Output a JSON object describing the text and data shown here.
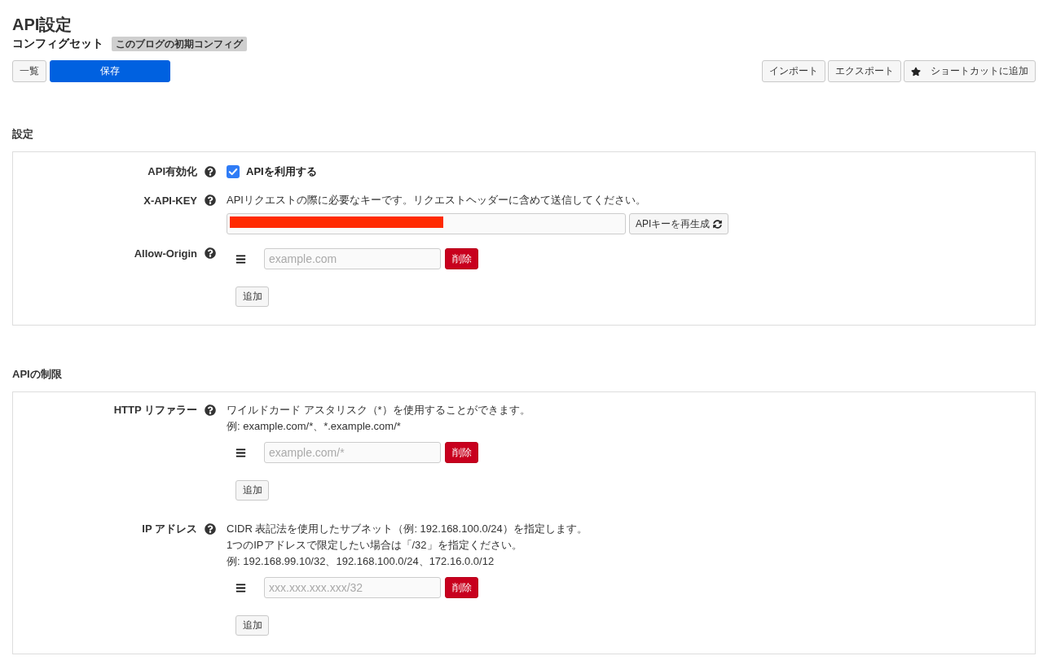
{
  "title": "API設定",
  "config_set": {
    "label": "コンフィグセット",
    "badge": "このブログの初期コンフィグ"
  },
  "toolbar": {
    "left": [
      {
        "label": "一覧",
        "kind": "default"
      },
      {
        "label": "保存",
        "kind": "primary"
      }
    ],
    "right": [
      {
        "label": "インポート",
        "kind": "default"
      },
      {
        "label": "エクスポート",
        "kind": "default"
      },
      {
        "label": "ショートカットに追加",
        "kind": "shortcut"
      }
    ]
  },
  "sections": [
    {
      "heading": "設定",
      "fields": [
        {
          "kind": "checkbox",
          "label": "API有効化",
          "checkbox": {
            "label": "APIを利用する",
            "checked": true
          }
        },
        {
          "kind": "api_key",
          "label": "X-API-KEY",
          "description": [
            "APIリクエストの際に必要なキーです。リクエストヘッダーに含めて送信してください。"
          ],
          "key_field": {
            "masked": true
          },
          "regenerate_button": "APIキーを再生成"
        },
        {
          "kind": "list",
          "label": "Allow-Origin",
          "items": [
            {
              "placeholder": "example.com",
              "delete_button": "削除"
            }
          ],
          "add_button": "追加"
        }
      ]
    },
    {
      "heading": "APIの制限",
      "fields": [
        {
          "kind": "list",
          "label": "HTTP リファラー",
          "description": [
            "ワイルドカード アスタリスク（*）を使用することができます。",
            "例: example.com/*、*.example.com/*"
          ],
          "items": [
            {
              "placeholder": "example.com/*",
              "delete_button": "削除"
            }
          ],
          "add_button": "追加"
        },
        {
          "kind": "list",
          "label": "IP アドレス",
          "description": [
            "CIDR 表記法を使用したサブネット（例: 192.168.100.0/24）を指定します。",
            "1つのIPアドレスで限定したい場合は「/32」を指定ください。",
            "例: 192.168.99.10/32、192.168.100.0/24、172.16.0.0/12"
          ],
          "items": [
            {
              "placeholder": "xxx.xxx.xxx.xxx/32",
              "delete_button": "削除"
            }
          ],
          "add_button": "追加"
        }
      ]
    }
  ]
}
